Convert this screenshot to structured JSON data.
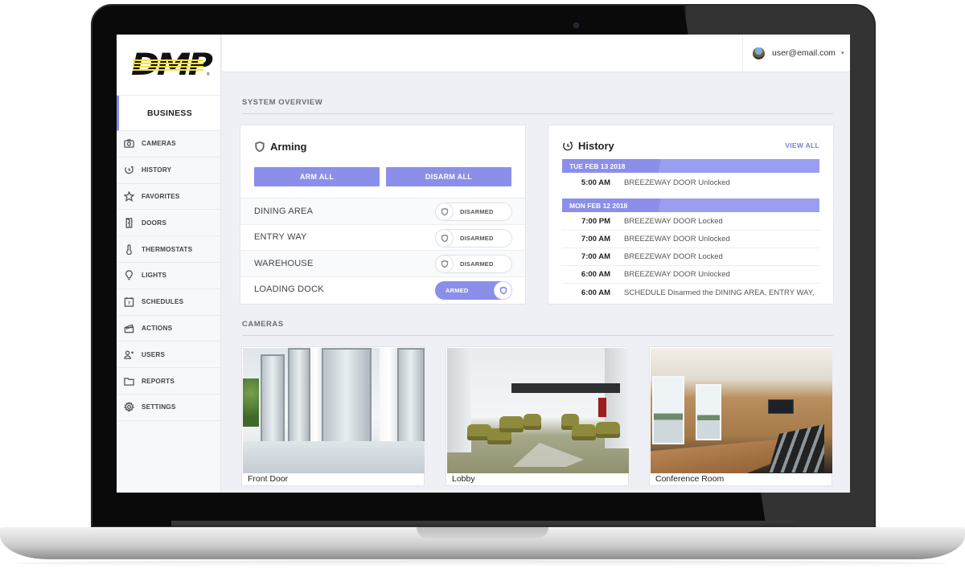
{
  "brand": {
    "logo_text": "DMP",
    "registered_mark": "®"
  },
  "sidebar": {
    "account_label": "BUSINESS",
    "items": [
      {
        "label": "CAMERAS",
        "icon": "camera-icon"
      },
      {
        "label": "HISTORY",
        "icon": "history-icon"
      },
      {
        "label": "FAVORITES",
        "icon": "star-icon"
      },
      {
        "label": "DOORS",
        "icon": "door-icon"
      },
      {
        "label": "THERMOSTATS",
        "icon": "thermometer-icon"
      },
      {
        "label": "LIGHTS",
        "icon": "lightbulb-icon"
      },
      {
        "label": "SCHEDULES",
        "icon": "calendar-icon"
      },
      {
        "label": "ACTIONS",
        "icon": "clapperboard-icon"
      },
      {
        "label": "USERS",
        "icon": "users-icon"
      },
      {
        "label": "REPORTS",
        "icon": "folder-icon"
      },
      {
        "label": "SETTINGS",
        "icon": "gear-icon"
      }
    ],
    "calendar_day": "7"
  },
  "header": {
    "user_email": "user@email.com",
    "caret": "▾"
  },
  "system_overview": {
    "section_label": "SYSTEM OVERVIEW",
    "arming": {
      "title": "Arming",
      "arm_all_label": "ARM ALL",
      "disarm_all_label": "DISARM ALL",
      "areas": [
        {
          "name": "DINING AREA",
          "status": "DISARMED",
          "armed": false
        },
        {
          "name": "ENTRY WAY",
          "status": "DISARMED",
          "armed": false
        },
        {
          "name": "WAREHOUSE",
          "status": "DISARMED",
          "armed": false
        },
        {
          "name": "LOADING DOCK",
          "status": "ARMED",
          "armed": true
        }
      ]
    },
    "history": {
      "title": "History",
      "view_all_label": "VIEW ALL",
      "groups": [
        {
          "date": "TUE FEB 13 2018",
          "events": [
            {
              "time": "5:00 AM",
              "text": "BREEZEWAY DOOR Unlocked"
            }
          ]
        },
        {
          "date": "MON FEB 12 2018",
          "events": [
            {
              "time": "7:00 PM",
              "text": "BREEZEWAY DOOR Locked"
            },
            {
              "time": "7:00 AM",
              "text": "BREEZEWAY DOOR Unlocked"
            },
            {
              "time": "7:00 AM",
              "text": "BREEZEWAY DOOR Locked"
            },
            {
              "time": "6:00 AM",
              "text": "BREEZEWAY DOOR Unlocked"
            },
            {
              "time": "6:00 AM",
              "text": "SCHEDULE Disarmed the DINING AREA, ENTRY WAY,"
            }
          ]
        }
      ]
    }
  },
  "cameras": {
    "section_label": "CAMERAS",
    "items": [
      {
        "label": "Front Door"
      },
      {
        "label": "Lobby"
      },
      {
        "label": "Conference Room"
      }
    ]
  },
  "colors": {
    "accent": "#8b8fe9",
    "accent_text": "#7c80d9",
    "logo_yellow": "#f3e33a",
    "background": "#eef0f5"
  }
}
